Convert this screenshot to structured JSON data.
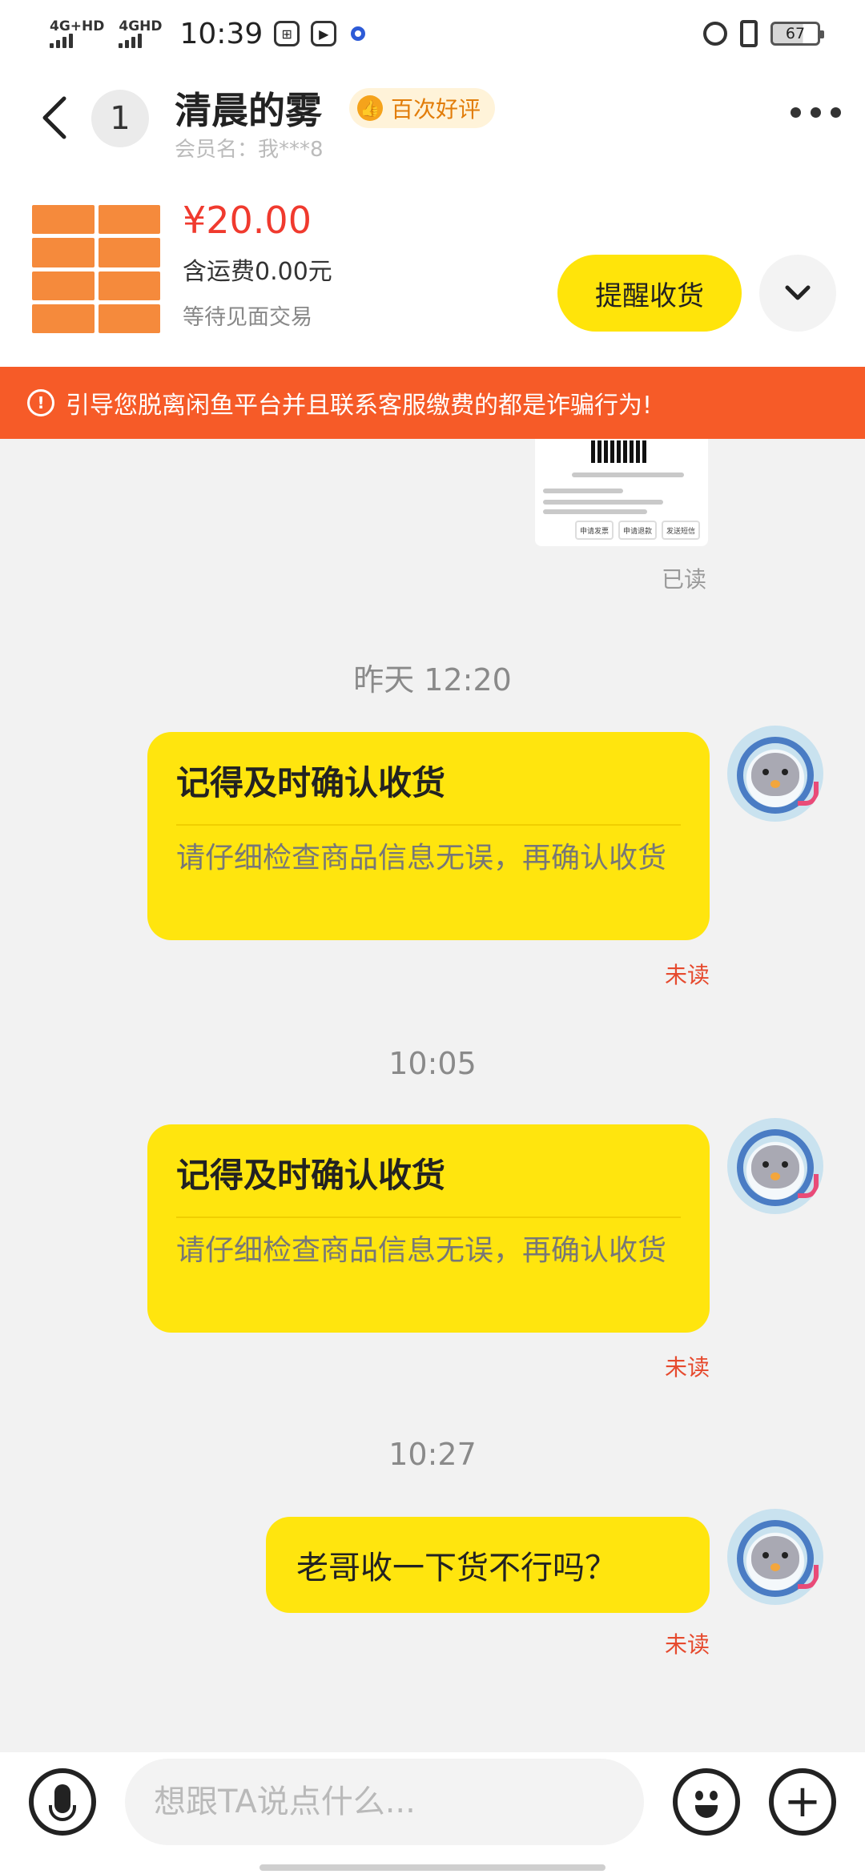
{
  "status_bar": {
    "network_1": "4G+HD",
    "network_2": "4GHD",
    "time": "10:39",
    "battery": "67"
  },
  "header": {
    "unread_count": "1",
    "nickname": "清晨的雾",
    "badge": "百次好评",
    "member": "会员名：我***8"
  },
  "product": {
    "price": "¥20.00",
    "shipping": "含运费0.00元",
    "status": "等待见面交易",
    "remind_button": "提醒收货"
  },
  "warning": "引导您脱离闲鱼平台并且联系客服缴费的都是诈骗行为!",
  "screenshot": {
    "buttons": [
      "申请发票",
      "申请退款",
      "发送短信"
    ]
  },
  "messages": {
    "read_label": "已读",
    "times": [
      "昨天 12:20",
      "10:05",
      "10:27"
    ],
    "card_title": "记得及时确认收货",
    "card_body": "请仔细检查商品信息无误，再确认收货",
    "text_message": "老哥收一下货不行吗？",
    "unread_label": "未读"
  },
  "input": {
    "placeholder": "想跟TA说点什么..."
  },
  "colors": {
    "accent_yellow": "#ffe50e",
    "warning_orange": "#f65b28",
    "price_red": "#f03a2e",
    "unread_red": "#e64a2e"
  },
  "icons": [
    "back-arrow-icon",
    "more-icon",
    "chevron-down-icon",
    "warning-circle-icon",
    "mic-icon",
    "emoji-icon",
    "plus-icon"
  ]
}
